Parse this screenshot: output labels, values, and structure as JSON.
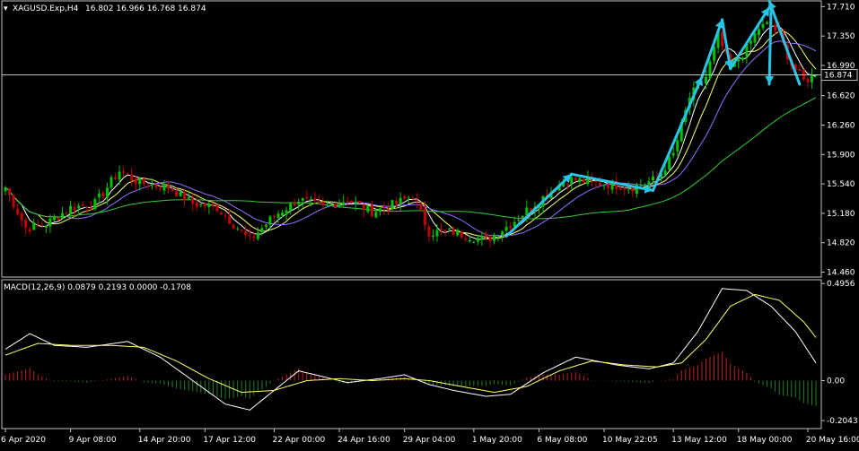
{
  "window": {
    "symbol_label": "XAGUSD.Exp,H4",
    "ohlc_label": "16.802 16.966 16.768 16.874",
    "macd_label": "MACD(12,26,9) 0.0879 0.2193 0.0000 -0.1708"
  },
  "colors": {
    "background": "#000000",
    "frame": "#c0c0c0",
    "candle_up": "#00c000",
    "candle_down": "#c00000",
    "ma_fast": "#ffffff",
    "ma_mid": "#ffff66",
    "ma_slow": "#9370ff",
    "ma_long": "#33cc33",
    "arrow": "#29c5e6",
    "macd_line": "#ffffff",
    "signal_line": "#ffff66",
    "hist_pos": "#c02020",
    "hist_neg": "#208020",
    "bid_line": "#c0c0c0"
  },
  "chart_data": [
    {
      "type": "candlestick",
      "title": "XAGUSD.Exp,H4",
      "ylim": [
        14.4,
        17.78
      ],
      "y_ticks": [
        "17.710",
        "17.350",
        "16.990",
        "16.620",
        "16.260",
        "15.900",
        "15.540",
        "15.180",
        "14.820",
        "14.460"
      ],
      "y_tick_values": [
        17.71,
        17.35,
        16.99,
        16.62,
        16.26,
        15.9,
        15.54,
        15.18,
        14.82,
        14.46
      ],
      "current_price": "16.874",
      "current_price_value": 16.874,
      "x_ticks": [
        "6 Apr 2020",
        "9 Apr 08:00",
        "14 Apr 20:00",
        "17 Apr 12:00",
        "22 Apr 00:00",
        "24 Apr 16:00",
        "29 Apr 04:00",
        "1 May 20:00",
        "6 May 08:00",
        "10 May 22:05",
        "13 May 12:00",
        "18 May 00:00",
        "20 May 16:00"
      ],
      "x_tick_index": [
        0,
        16,
        33,
        49,
        66,
        82,
        98,
        115,
        131,
        147,
        164,
        180,
        197
      ],
      "candle_count": 200,
      "close_anchors": [
        [
          0,
          15.5
        ],
        [
          5,
          15.0
        ],
        [
          10,
          15.05
        ],
        [
          16,
          15.25
        ],
        [
          22,
          15.3
        ],
        [
          28,
          15.7
        ],
        [
          33,
          15.55
        ],
        [
          40,
          15.5
        ],
        [
          46,
          15.3
        ],
        [
          52,
          15.25
        ],
        [
          57,
          15.0
        ],
        [
          60,
          14.85
        ],
        [
          66,
          15.15
        ],
        [
          72,
          15.35
        ],
        [
          78,
          15.25
        ],
        [
          84,
          15.35
        ],
        [
          90,
          15.2
        ],
        [
          96,
          15.3
        ],
        [
          100,
          15.4
        ],
        [
          104,
          14.95
        ],
        [
          110,
          14.95
        ],
        [
          118,
          14.85
        ],
        [
          124,
          15.05
        ],
        [
          130,
          15.3
        ],
        [
          138,
          15.6
        ],
        [
          146,
          15.55
        ],
        [
          154,
          15.5
        ],
        [
          160,
          15.6
        ],
        [
          164,
          15.9
        ],
        [
          168,
          16.6
        ],
        [
          172,
          16.85
        ],
        [
          175,
          17.35
        ],
        [
          178,
          16.95
        ],
        [
          182,
          17.2
        ],
        [
          185,
          17.45
        ],
        [
          188,
          17.5
        ],
        [
          190,
          17.35
        ],
        [
          193,
          17.0
        ],
        [
          196,
          16.8
        ],
        [
          199,
          16.874
        ]
      ],
      "arrow_points": [
        [
          123,
          14.9
        ],
        [
          139,
          15.66
        ],
        [
          159,
          15.46
        ],
        [
          171,
          16.85
        ],
        [
          176,
          17.55
        ],
        [
          178,
          16.95
        ],
        [
          188,
          17.7
        ],
        [
          195,
          16.76
        ],
        [
          221,
          17.78
        ]
      ]
    },
    {
      "type": "line",
      "title": "MACD(12,26,9) 0.0879 0.2193 0.0000 -0.1708",
      "ylim": [
        -0.245,
        0.515
      ],
      "y_ticks": [
        "0.4956",
        "0.00",
        "-0.2043"
      ],
      "y_tick_values": [
        0.4956,
        0.0,
        -0.2043
      ],
      "series": [
        {
          "name": "MACD",
          "anchors": [
            [
              0,
              0.16
            ],
            [
              6,
              0.24
            ],
            [
              12,
              0.18
            ],
            [
              20,
              0.17
            ],
            [
              30,
              0.2
            ],
            [
              38,
              0.12
            ],
            [
              46,
              0.0
            ],
            [
              54,
              -0.12
            ],
            [
              60,
              -0.15
            ],
            [
              66,
              -0.05
            ],
            [
              72,
              0.05
            ],
            [
              78,
              0.02
            ],
            [
              84,
              -0.01
            ],
            [
              92,
              0.01
            ],
            [
              98,
              0.03
            ],
            [
              104,
              -0.02
            ],
            [
              110,
              -0.05
            ],
            [
              118,
              -0.08
            ],
            [
              124,
              -0.07
            ],
            [
              132,
              0.04
            ],
            [
              140,
              0.12
            ],
            [
              150,
              0.08
            ],
            [
              158,
              0.06
            ],
            [
              164,
              0.09
            ],
            [
              170,
              0.25
            ],
            [
              176,
              0.47
            ],
            [
              182,
              0.46
            ],
            [
              188,
              0.38
            ],
            [
              194,
              0.25
            ],
            [
              199,
              0.09
            ]
          ]
        },
        {
          "name": "Signal",
          "anchors": [
            [
              0,
              0.13
            ],
            [
              8,
              0.19
            ],
            [
              16,
              0.18
            ],
            [
              26,
              0.18
            ],
            [
              34,
              0.17
            ],
            [
              42,
              0.1
            ],
            [
              50,
              0.01
            ],
            [
              58,
              -0.06
            ],
            [
              66,
              -0.05
            ],
            [
              74,
              0.0
            ],
            [
              82,
              0.01
            ],
            [
              90,
              0.0
            ],
            [
              98,
              0.01
            ],
            [
              104,
              0.0
            ],
            [
              112,
              -0.03
            ],
            [
              120,
              -0.06
            ],
            [
              128,
              -0.03
            ],
            [
              136,
              0.05
            ],
            [
              144,
              0.1
            ],
            [
              152,
              0.08
            ],
            [
              160,
              0.07
            ],
            [
              166,
              0.09
            ],
            [
              172,
              0.21
            ],
            [
              178,
              0.38
            ],
            [
              184,
              0.44
            ],
            [
              190,
              0.41
            ],
            [
              196,
              0.3
            ],
            [
              199,
              0.22
            ]
          ]
        }
      ],
      "histogram_note": "histogram = MACD - Signal"
    }
  ]
}
